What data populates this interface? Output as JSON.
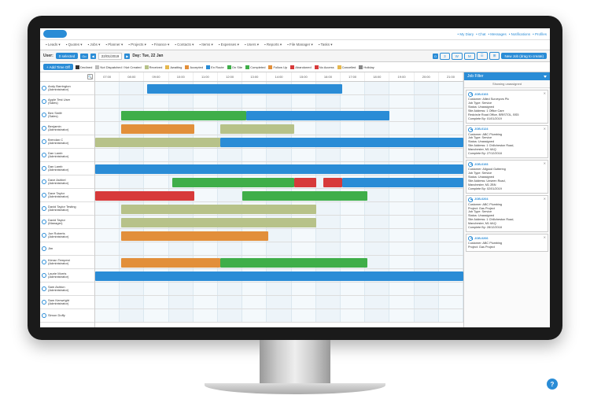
{
  "topnav_right": [
    "My Diary",
    "Chat",
    "Messages",
    "Notifications",
    "Profiles"
  ],
  "mainnav": [
    "Leads",
    "Quotes",
    "Jobs",
    "Planner",
    "Projects",
    "Finance",
    "Contacts",
    "Items",
    "Expenses",
    "Users",
    "Reports",
    "File Manager",
    "Tasks"
  ],
  "toolbar": {
    "user_label": "User:",
    "selected_btn": "0 selected",
    "go_btn": "Go",
    "date": "22/01/2019",
    "day_label": "Day: Tue, 22 Jan",
    "add_time_off": "+ Add Time Off",
    "new_job": "New Job (drag to create)",
    "view_d": "D",
    "view_3": "3",
    "view_w": "W",
    "view_m": "M"
  },
  "legend": [
    {
      "color": "#333333",
      "label": "Declined"
    },
    {
      "color": "#bdbdbd",
      "label": "Not Dispatched / Not Created"
    },
    {
      "color": "#b7c289",
      "label": "Received"
    },
    {
      "color": "#e6b84f",
      "label": "Awaiting"
    },
    {
      "color": "#e28f3a",
      "label": "Accepted"
    },
    {
      "color": "#2a8cd6",
      "label": "En Route"
    },
    {
      "color": "#3fae49",
      "label": "On Site"
    },
    {
      "color": "#3fae49",
      "label": "Completed"
    },
    {
      "color": "#e28f3a",
      "label": "Follow Up"
    },
    {
      "color": "#d73a3a",
      "label": "Abandoned"
    },
    {
      "color": "#d73a3a",
      "label": "No Access"
    },
    {
      "color": "#e6b84f",
      "label": "Cancelled"
    },
    {
      "color": "#888888",
      "label": "Holiday"
    }
  ],
  "hours": [
    "07:00",
    "08:00",
    "09:00",
    "10:00",
    "11:00",
    "12:00",
    "13:00",
    "14:00",
    "15:00",
    "16:00",
    "17:00",
    "18:00",
    "19:00",
    "20:00",
    "21:00"
  ],
  "users": [
    {
      "name": "Andy Barrington",
      "role": "(Administrator)"
    },
    {
      "name": "Apple Test User",
      "role": "(Sales)"
    },
    {
      "name": "Ben Smith",
      "role": "(Sales)"
    },
    {
      "name": "Benjamin",
      "role": "(Administrator)"
    },
    {
      "name": "Brendan C",
      "role": "(Administrator)"
    },
    {
      "name": "Dan Lamb",
      "role": "(Administrator)"
    },
    {
      "name": "Dan Lamb",
      "role": "(Administrator)"
    },
    {
      "name": "Dave Ashbel",
      "role": "(Administrator)"
    },
    {
      "name": "Dave Taylor",
      "role": "(Administrator)"
    },
    {
      "name": "David Taylor Testing",
      "role": "(Administrator)"
    },
    {
      "name": "David Taylor",
      "role": "(Manager)"
    },
    {
      "name": "Joe Roberts",
      "role": "(Administrator)"
    },
    {
      "name": "Jim",
      "role": ""
    },
    {
      "name": "Kieran Tempest",
      "role": "(Administrator)"
    },
    {
      "name": "Laurie Morris",
      "role": "(Administrator)"
    },
    {
      "name": "Sam Ashton",
      "role": "(Administrator)"
    },
    {
      "name": "Sam Kenwright",
      "role": "(Administrator)"
    },
    {
      "name": "Simon Duffy",
      "role": ""
    }
  ],
  "bars": [
    {
      "row": 0,
      "start": 14,
      "end": 67,
      "color": "#2a8cd6"
    },
    {
      "row": 2,
      "start": 7,
      "end": 41,
      "color": "#3fae49"
    },
    {
      "row": 2,
      "start": 41,
      "end": 80,
      "color": "#2a8cd6"
    },
    {
      "row": 3,
      "start": 7,
      "end": 27,
      "color": "#e28f3a"
    },
    {
      "row": 3,
      "start": 34,
      "end": 54,
      "color": "#b7c289"
    },
    {
      "row": 4,
      "start": 0,
      "end": 34,
      "color": "#b7c289"
    },
    {
      "row": 4,
      "start": 34,
      "end": 100,
      "color": "#2a8cd6"
    },
    {
      "row": 6,
      "start": 0,
      "end": 100,
      "color": "#2a8cd6"
    },
    {
      "row": 7,
      "start": 21,
      "end": 54,
      "color": "#3fae49"
    },
    {
      "row": 7,
      "start": 54,
      "end": 60,
      "color": "#d73a3a"
    },
    {
      "row": 7,
      "start": 62,
      "end": 67,
      "color": "#d73a3a"
    },
    {
      "row": 7,
      "start": 67,
      "end": 100,
      "color": "#2a8cd6"
    },
    {
      "row": 8,
      "start": 0,
      "end": 27,
      "color": "#d73a3a"
    },
    {
      "row": 8,
      "start": 40,
      "end": 74,
      "color": "#3fae49"
    },
    {
      "row": 9,
      "start": 7,
      "end": 60,
      "color": "#b7c289"
    },
    {
      "row": 10,
      "start": 7,
      "end": 60,
      "color": "#b7c289"
    },
    {
      "row": 11,
      "start": 7,
      "end": 47,
      "color": "#e28f3a"
    },
    {
      "row": 13,
      "start": 7,
      "end": 34,
      "color": "#e28f3a"
    },
    {
      "row": 13,
      "start": 34,
      "end": 74,
      "color": "#3fae49"
    },
    {
      "row": 14,
      "start": 0,
      "end": 100,
      "color": "#2a8cd6"
    }
  ],
  "sidebar": {
    "title": "Job Filter",
    "showing": "Showing unassigned",
    "jobs": [
      {
        "id": "JOB-0103",
        "lines": [
          "Customer: Allied Surveyors Plc",
          "Job Type: Service",
          "Status: Unassigned",
          "Site Address: 1 Office Care",
          "Redcircle Road Office, BRISTOL, BS5",
          "Complete By: 01/01/2019"
        ]
      },
      {
        "id": "JOB-0124",
        "lines": [
          "Customer: ABC Plumbing",
          "Job Type: Service",
          "Status: Unassigned",
          "Site Address: 1 Chillcheston Road,",
          "Manchester, M1 6AQ",
          "Complete By: 27/12/2018"
        ]
      },
      {
        "id": "JOB-0193",
        "lines": [
          "Customer: Allgood Guttering",
          "Job Type: Service",
          "Status: Unassigned",
          "Site Address: Unseen Road,",
          "Manchester, M1 2BN",
          "Complete By: 02/01/2019"
        ]
      },
      {
        "id": "JOB-0204",
        "lines": [
          "Customer: ABC Plumbing",
          "Project: Gas Project",
          "Job Type: Service",
          "Status: Unassigned",
          "Site Address: 1 Chillcheston Road,",
          "Manchester, M1 6AQ",
          "Complete By: 28/12/2018"
        ]
      },
      {
        "id": "JOB-0206",
        "lines": [
          "Customer: ABC Plumbing",
          "Project: Gas Project"
        ]
      }
    ]
  }
}
